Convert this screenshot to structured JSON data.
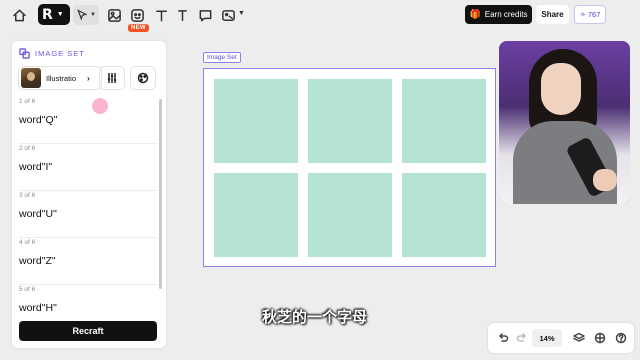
{
  "toolbar": {
    "icons": [
      "home-icon",
      "logo-r",
      "pointer-icon",
      "image-icon",
      "sticker-icon",
      "text-icon",
      "comment-icon",
      "media-icon"
    ],
    "new_badge": "NEW",
    "earn_credits_label": "Earn credits",
    "share_label": "Share",
    "credits_count": "767"
  },
  "panel": {
    "title": "IMAGE SET",
    "style_label": "Illustratio",
    "items": [
      {
        "count": "1 of 6",
        "prompt": "word\"Q\""
      },
      {
        "count": "2 of 6",
        "prompt": "word\"I\""
      },
      {
        "count": "3 of 6",
        "prompt": "word\"U\""
      },
      {
        "count": "4 of 6",
        "prompt": "word\"Z\""
      },
      {
        "count": "5 of 6",
        "prompt": "word\"H\""
      }
    ],
    "recraft_label": "Recraft"
  },
  "canvas": {
    "frame_label": "Image Set",
    "tile_color": "#b4e3d6",
    "tile_count": 6
  },
  "subtitle": "秋芝的一个字母",
  "bottom": {
    "zoom": "14%"
  },
  "colors": {
    "accent": "#6b5be6",
    "primary_button": "#111111",
    "badge": "#f4511e"
  }
}
